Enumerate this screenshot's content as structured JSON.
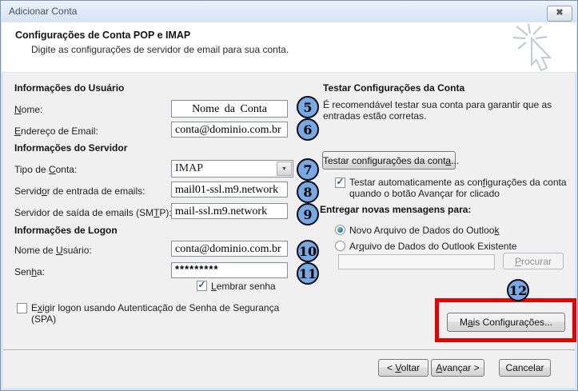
{
  "window": {
    "title": "Adicionar Conta"
  },
  "icons": {
    "close": "✖",
    "dropdown": "▼",
    "check": "✓"
  },
  "header": {
    "title": "Configurações de Conta POP e IMAP",
    "subtitle": "Digite as configurações de servidor de email para sua conta."
  },
  "user_info": {
    "section": "Informações do Usuário",
    "name_label": "&Nome:",
    "name_value": "Nome da Conta",
    "email_label": "&Endereço de Email:",
    "email_value": "conta@dominio.com.br"
  },
  "server_info": {
    "section": "Informações do Servidor",
    "account_type_label": "Tipo de &Conta:",
    "account_type_value": "IMAP",
    "incoming_label": "Servid&or de entrada de emails:",
    "incoming_value": "mail01-ssl.m9.network",
    "outgoing_label": "Servidor de saída de emails (SM&TP):",
    "outgoing_value": "mail-ssl.m9.network"
  },
  "logon_info": {
    "section": "Informações de Logon",
    "username_label": "Nome de &Usuário:",
    "username_value": "conta@dominio.com.br",
    "password_label": "Sen&ha:",
    "password_value": "*********",
    "remember_label": "&Lembrar senha",
    "spa_label": "E&xigir logon usando Autenticação de Senha de Segurança (SPA)"
  },
  "test_section": {
    "heading": "Testar Configurações da Conta",
    "description": "É recomendável testar sua conta para garantir que as entradas estão corretas.",
    "test_button": "Testar configurações da cont&a...",
    "auto_test_label": "Testar automaticamente as con&figurações da conta quando o botão Avançar for clicado"
  },
  "delivery": {
    "heading": "Entregar novas mensagens para:",
    "option_new": "Novo Arquivo de Dados do Outloo&k",
    "option_existing": "Ar&quivo de Dados do Outlook Existente",
    "existing_path_value": "",
    "browse_button": "&Procurar"
  },
  "more_settings_button": "M&ais Configurações...",
  "footer": {
    "back": "< &Voltar",
    "next": "&Avançar >",
    "cancel": "Cancelar"
  },
  "annotations": {
    "steps": [
      "5",
      "6",
      "7",
      "8",
      "9",
      "10",
      "11",
      "12"
    ]
  },
  "colors": {
    "badge_fill": "#79A9E3",
    "highlight_red": "#E60000",
    "titlebar": "#DCE9F7"
  }
}
